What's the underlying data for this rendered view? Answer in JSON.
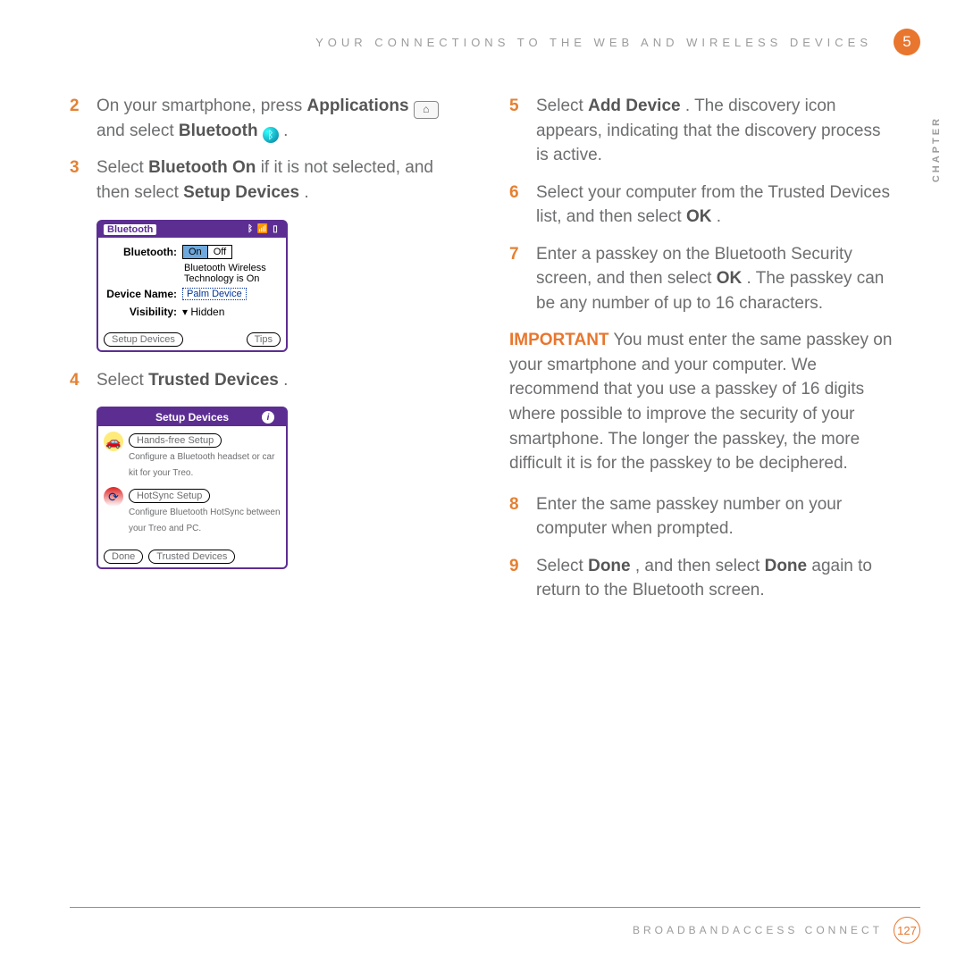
{
  "header": "YOUR CONNECTIONS TO THE WEB AND WIRELESS DEVICES",
  "chapter_number": "5",
  "chapter_label": "CHAPTER",
  "left_steps": [
    {
      "n": "2",
      "parts": {
        "a": "On your smartphone, press ",
        "b": "Applications",
        "c": " and select ",
        "d": "Bluetooth",
        "e": " ."
      }
    },
    {
      "n": "3",
      "parts": {
        "a": "Select ",
        "b": "Bluetooth On",
        "c": " if it is not selected, and then select ",
        "d": "Setup Devices",
        "e": "."
      }
    },
    {
      "n": "4",
      "parts": {
        "a": "Select ",
        "b": "Trusted Devices",
        "c": "."
      }
    }
  ],
  "right_steps": [
    {
      "n": "5",
      "parts": {
        "a": "Select ",
        "b": "Add Device",
        "c": ". The discovery icon appears, indicating that the discovery process is active."
      }
    },
    {
      "n": "6",
      "parts": {
        "a": "Select your computer from the Trusted Devices list, and then select ",
        "b": "OK",
        "c": "."
      }
    },
    {
      "n": "7",
      "parts": {
        "a": "Enter a passkey on the Bluetooth Security screen, and then select ",
        "b": "OK",
        "c": ". The passkey can be any number of up to 16 characters."
      }
    },
    {
      "n": "8",
      "parts": {
        "a": "Enter the same passkey number on your computer when prompted."
      }
    },
    {
      "n": "9",
      "parts": {
        "a": "Select ",
        "b": "Done",
        "c": ", and then select ",
        "d": "Done",
        "e": " again to return to the Bluetooth screen."
      }
    }
  ],
  "important": {
    "label": "IMPORTANT",
    "text": "  You must enter the same passkey on your smartphone and your computer. We recommend that you use a passkey of 16 digits where possible to improve the security of your smartphone. The longer the passkey, the more difficult it is for the passkey to be deciphered."
  },
  "device1": {
    "title": "Bluetooth",
    "bt_label": "Bluetooth:",
    "on": "On",
    "off": "Off",
    "status": "Bluetooth Wireless Technology is On",
    "name_label": "Device Name:",
    "name_val": "Palm Device",
    "vis_label": "Visibility:",
    "vis_val": "Hidden",
    "btn_setup": "Setup Devices",
    "btn_tips": "Tips"
  },
  "device2": {
    "title": "Setup Devices",
    "item1_btn": "Hands-free Setup",
    "item1_sub": "Configure a Bluetooth headset or car kit for your Treo.",
    "item2_btn": "HotSync Setup",
    "item2_sub": "Configure Bluetooth HotSync between your Treo and PC.",
    "btn_done": "Done",
    "btn_trusted": "Trusted Devices"
  },
  "footer": "BROADBANDACCESS CONNECT",
  "page": "127"
}
